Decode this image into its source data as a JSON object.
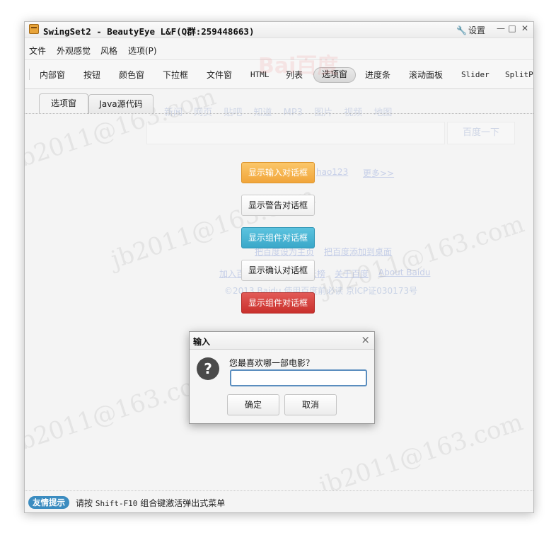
{
  "window": {
    "title": "SwingSet2 - BeautyEye L&F(Q群:259448663)",
    "settings_label": "设置"
  },
  "menubar": {
    "items": [
      "文件",
      "外观感觉",
      "风格",
      "选项(P)"
    ]
  },
  "toolbar": {
    "items": [
      "内部窗",
      "按钮",
      "颜色窗",
      "下拉框",
      "文件窗",
      "HTML",
      "列表",
      "选项窗",
      "进度条",
      "滚动面板",
      "Slider",
      "SplitPa"
    ],
    "active": "选项窗"
  },
  "tabs": {
    "items": [
      "选项窗",
      "Java源代码"
    ],
    "active": "选项窗"
  },
  "buttons": {
    "input_dialog": "显示输入对话框",
    "warning_dialog": "显示警告对话框",
    "component_dialog": "显示组件对话框",
    "confirm_dialog": "显示确认对话框",
    "component_dialog2": "显示组件对话框"
  },
  "background": {
    "baidu_nav": [
      "新闻",
      "网页",
      "贴吧",
      "知道",
      "MP3",
      "图片",
      "视频",
      "地图"
    ],
    "baidu_button": "百度一下",
    "links_row": [
      "hao123",
      "更多>>"
    ],
    "home_links": [
      "把百度设为主页",
      "把百度添加到桌面"
    ],
    "footer_links": [
      "加入百度推广",
      "搜索风云榜",
      "关于百度",
      "About Baidu"
    ],
    "copyright": "©2013 Baidu 使用百度前必读 京ICP证030173号",
    "watermark": "jb2011@163.com"
  },
  "dialog": {
    "title": "输入",
    "prompt": "您最喜欢哪一部电影？",
    "input_value": "",
    "ok": "确定",
    "cancel": "取消"
  },
  "statusbar": {
    "badge": "友情提示",
    "text_prefix": "请按 ",
    "text_key": "Shift-F10",
    "text_suffix": " 组合键激活弹出式菜单"
  }
}
